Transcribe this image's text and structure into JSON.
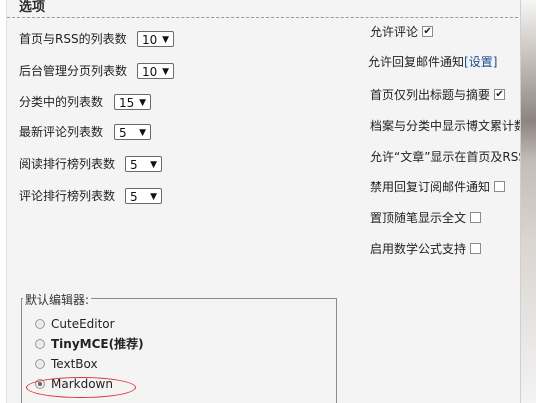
{
  "section_title": "选项",
  "left_options": [
    {
      "label": "首页与RSS的列表数",
      "value": "10"
    },
    {
      "label": "后台管理分页列表数",
      "value": "10"
    },
    {
      "label": "分类中的列表数",
      "value": "15"
    },
    {
      "label": "最新评论列表数",
      "value": "5"
    },
    {
      "label": "阅读排行榜列表数",
      "value": "5"
    },
    {
      "label": "评论排行榜列表数",
      "value": "5"
    }
  ],
  "right_options": {
    "allow_comment": {
      "label": "允许评论",
      "checked": true
    },
    "allow_reply_email": {
      "label": "允许回复邮件通知",
      "link": "[设置]"
    },
    "home_titles_only": {
      "label": "首页仅列出标题与摘要",
      "checked": true
    },
    "archive_stats": {
      "label": "档案与分类中显示博文累计数"
    },
    "allow_article_home": {
      "label": "允许“文章”显示在首页及RSS"
    },
    "disable_reply_subscription": {
      "label": "禁用回复订阅邮件通知",
      "checked": false
    },
    "pin_full_text": {
      "label": "置顶随笔显示全文",
      "checked": false
    },
    "enable_math": {
      "label": "启用数学公式支持",
      "checked": false
    }
  },
  "editor": {
    "legend": "默认编辑器:",
    "options": [
      {
        "label": "CuteEditor",
        "checked": false
      },
      {
        "label": "TinyMCE(推荐)",
        "checked": false
      },
      {
        "label": "TextBox",
        "checked": false
      },
      {
        "label": "Markdown",
        "checked": true
      }
    ]
  },
  "colors": {
    "annotation": "#d9343a",
    "link": "#1a4d8f"
  },
  "select_arrow": "▼",
  "check_mark": "✔"
}
